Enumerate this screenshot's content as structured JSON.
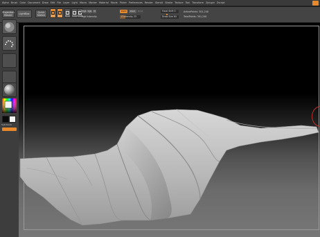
{
  "menu": {
    "items": [
      "Alpha",
      "Brush",
      "Color",
      "Document",
      "Draw",
      "Edit",
      "File",
      "Layer",
      "Light",
      "Macro",
      "Marker",
      "Material",
      "Movie",
      "Picker",
      "Preferences",
      "Render",
      "Stencil",
      "Stroke",
      "Texture",
      "Tool",
      "Transform",
      "Zplugin",
      "Zscript"
    ]
  },
  "shelf": {
    "projection_master": "Projection\nMaster",
    "lightbox": "LightBox",
    "quick_sketch": "Quick\nSketch",
    "tool_buttons": [
      {
        "label": "Edit",
        "state": "on"
      },
      {
        "label": "Draw",
        "state": "on"
      },
      {
        "label": "Move",
        "state": "off"
      },
      {
        "label": "Scale",
        "state": "off"
      },
      {
        "label": "Rotate",
        "state": "off"
      }
    ],
    "mrgb": "Mrgb",
    "rgb": "Rgb",
    "m": "M",
    "zadd": "Zadd",
    "zsub": "Zsub",
    "zcut": "Zcut",
    "rgb_intensity": "Rgb Intensity",
    "z_intensity": "Z Intensity",
    "z_intensity_value": 25,
    "focal_shift": "Focal Shift",
    "focal_shift_value": 0,
    "draw_size": "Draw Size",
    "draw_size_value": 64,
    "active_points": "ActivePoints: 301,240",
    "total_points": "TotalPoints: 301,240"
  },
  "tray": {
    "switch_color": "SwitchColor"
  },
  "colors": {
    "accent": "#e8892c",
    "cursor_ring": "#c0302a",
    "frame": "#9a9a9a"
  }
}
